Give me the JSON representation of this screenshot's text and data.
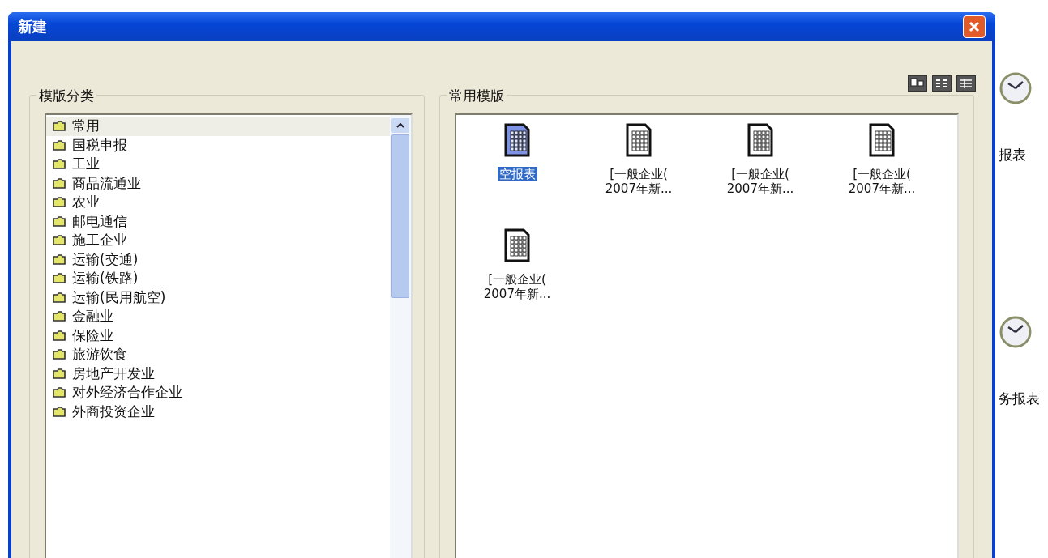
{
  "window": {
    "title": "新建"
  },
  "categories": {
    "legend": "模版分类",
    "items": [
      {
        "label": "常用",
        "selected": true
      },
      {
        "label": "国税申报",
        "selected": false
      },
      {
        "label": "工业",
        "selected": false
      },
      {
        "label": "商品流通业",
        "selected": false
      },
      {
        "label": "农业",
        "selected": false
      },
      {
        "label": "邮电通信",
        "selected": false
      },
      {
        "label": "施工企业",
        "selected": false
      },
      {
        "label": "运输(交通)",
        "selected": false
      },
      {
        "label": "运输(铁路)",
        "selected": false
      },
      {
        "label": "运输(民用航空)",
        "selected": false
      },
      {
        "label": "金融业",
        "selected": false
      },
      {
        "label": "保险业",
        "selected": false
      },
      {
        "label": "旅游饮食",
        "selected": false
      },
      {
        "label": "房地产开发业",
        "selected": false
      },
      {
        "label": "对外经济合作企业",
        "selected": false
      },
      {
        "label": "外商投资企业",
        "selected": false
      }
    ]
  },
  "templates": {
    "legend": "常用模版",
    "items": [
      {
        "kind": "blank",
        "lines": [
          "空报表"
        ],
        "selected": true
      },
      {
        "kind": "template",
        "lines": [
          "[一般企业(",
          "2007年新..."
        ],
        "selected": false
      },
      {
        "kind": "template",
        "lines": [
          "[一般企业(",
          "2007年新..."
        ],
        "selected": false
      },
      {
        "kind": "template",
        "lines": [
          "[一般企业(",
          "2007年新..."
        ],
        "selected": false
      },
      {
        "kind": "template",
        "lines": [
          "[一般企业(",
          "2007年新..."
        ],
        "selected": false
      }
    ]
  },
  "background_window": {
    "labels": [
      "报表",
      "务报表"
    ]
  }
}
